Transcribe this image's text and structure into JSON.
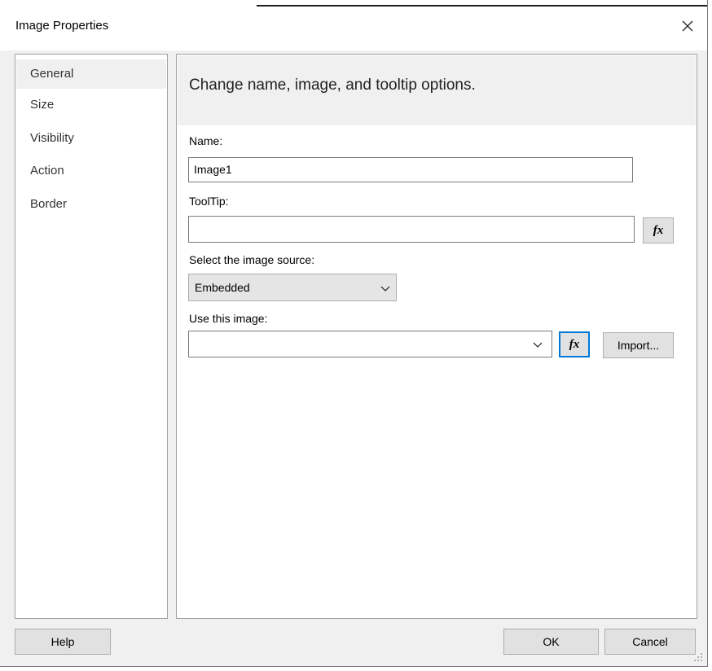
{
  "window": {
    "title": "Image Properties"
  },
  "icons": {
    "close": "close-icon",
    "fx": "function-fx-icon",
    "chevron": "chevron-down-icon"
  },
  "sidebar": {
    "items": [
      {
        "label": "General",
        "active": true
      },
      {
        "label": "Size"
      },
      {
        "label": "Visibility"
      },
      {
        "label": "Action"
      },
      {
        "label": "Border"
      }
    ]
  },
  "main": {
    "header": "Change name, image, and tooltip options.",
    "name": {
      "label": "Name:",
      "value": "Image1"
    },
    "tooltip": {
      "label": "ToolTip:",
      "value": ""
    },
    "fx_label": "fx",
    "source": {
      "label": "Select the image source:",
      "selected": "Embedded"
    },
    "use_image": {
      "label": "Use this image:",
      "value": ""
    },
    "import_label": "Import..."
  },
  "footer": {
    "help": "Help",
    "ok": "OK",
    "cancel": "Cancel"
  },
  "colors": {
    "accent": "#0078d7",
    "panel": "#f0f0f0",
    "border": "#a0a0a0"
  }
}
